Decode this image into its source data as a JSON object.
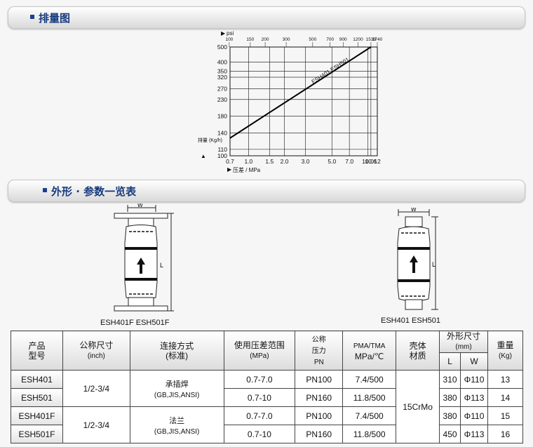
{
  "sections": {
    "chart_title": "排量图",
    "dims_title": "外形 · 参数一览表"
  },
  "chart_data": {
    "type": "line",
    "x_top_unit": "psi",
    "x_top_ticks": [
      "100",
      "150",
      "200",
      "300",
      "500",
      "700",
      "900",
      "1200",
      "1539",
      "1740"
    ],
    "x_bottom_ticks": [
      "0.7",
      "1.0",
      "1.5",
      "2.0",
      "3.0",
      "5.0",
      "7.0",
      "10.0",
      "10.6",
      "12"
    ],
    "xlabel": "压差 / MPa",
    "ylabel": "排量 (Kg/h)",
    "y_ticks": [
      "500",
      "400",
      "350",
      "320",
      "270",
      "230",
      "180",
      "140",
      "110",
      "100"
    ],
    "series": [
      {
        "name": "ESH401  ESH501",
        "x": [
          0.7,
          10.6
        ],
        "y": [
          130,
          500
        ]
      }
    ],
    "grid": true
  },
  "drawings": {
    "flanged_label": "ESH401F  ESH501F",
    "welded_label": "ESH401    ESH501",
    "dim_w": "W",
    "dim_l": "L"
  },
  "table": {
    "headers": {
      "product": "产品",
      "model": "型号",
      "size": "公称尺寸",
      "size_unit": "(inch)",
      "connection": "连接方式",
      "connection_std": "(标准)",
      "pressure": "使用压差范围",
      "pressure_unit": "(MPa)",
      "pn1": "公称",
      "pn2": "压力",
      "pn3": "PN",
      "pma1": "PMA/TMA",
      "pma2": "MPa/℃",
      "body1": "壳体",
      "body2": "材质",
      "dims": "外形尺寸",
      "dims_unit": "(mm)",
      "dim_l": "L",
      "dim_w": "W",
      "weight": "重量",
      "weight_unit": "(Kg)"
    },
    "rows": [
      {
        "model": "ESH401",
        "range": "0.7-7.0",
        "pn": "PN100",
        "pma": "7.4/500",
        "l": "310",
        "w": "Φ110",
        "kg": "13"
      },
      {
        "model": "ESH501",
        "range": "0.7-10",
        "pn": "PN160",
        "pma": "11.8/500",
        "l": "380",
        "w": "Φ113",
        "kg": "14"
      },
      {
        "model": "ESH401F",
        "range": "0.7-7.0",
        "pn": "PN100",
        "pma": "7.4/500",
        "l": "380",
        "w": "Φ110",
        "kg": "15"
      },
      {
        "model": "ESH501F",
        "range": "0.7-10",
        "pn": "PN160",
        "pma": "11.8/500",
        "l": "450",
        "w": "Φ113",
        "kg": "16"
      }
    ],
    "group1": {
      "size": "1/2-3/4",
      "conn1": "承插焊",
      "conn2": "(GB,JIS,ANSI)"
    },
    "group2": {
      "size": "1/2-3/4",
      "conn1": "法兰",
      "conn2": "(GB,JIS,ANSI)"
    },
    "material": "15CrMo"
  }
}
